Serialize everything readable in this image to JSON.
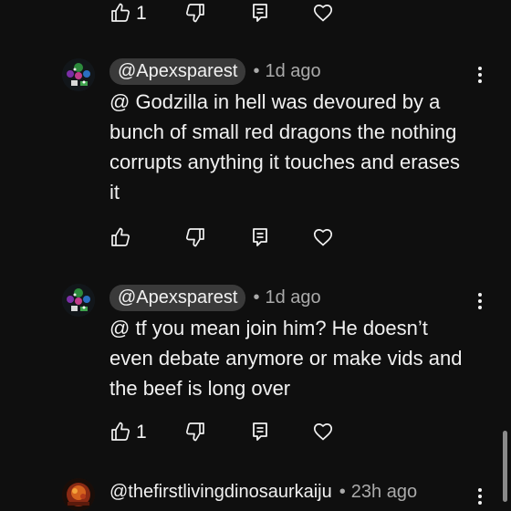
{
  "top_actions": {
    "like_count": "1"
  },
  "comments": [
    {
      "handle": "@Apexsparest",
      "separator": "•",
      "time": "1d ago",
      "text": "@ Godzilla in hell was devoured by a bunch of small red dragons the nothing corrupts anything it touches and erases it",
      "like_count": ""
    },
    {
      "handle": "@Apexsparest",
      "separator": "•",
      "time": "1d ago",
      "text": "@ tf you mean join him? He doesn’t even debate anymore or make vids and the beef is long over",
      "like_count": "1"
    },
    {
      "handle": "@thefirstlivingdinosaurkaiju",
      "separator": "•",
      "time": "23h ago"
    }
  ],
  "icons": {
    "like": "thumbs-up-icon",
    "dislike": "thumbs-down-icon",
    "reply": "reply-icon",
    "heart": "heart-icon",
    "more": "more-vert-icon"
  },
  "colors": {
    "background": "#0f0f0f",
    "text": "#f1f1f1",
    "secondary_text": "#aaaaaa",
    "handle_pill": "#3a3a3a"
  }
}
